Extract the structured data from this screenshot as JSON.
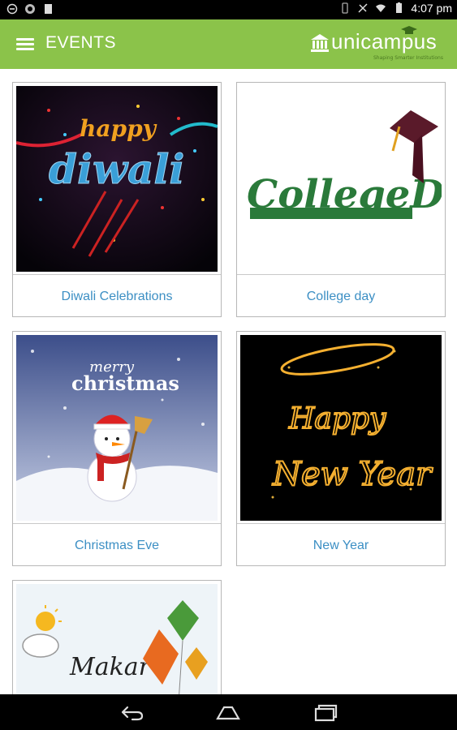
{
  "status_bar": {
    "time": "4:07 pm",
    "left_icons": [
      "minus-circle-icon",
      "sync-icon",
      "sd-card-icon"
    ],
    "right_icons": [
      "vibrate-icon",
      "no-signal-icon",
      "wifi-icon",
      "battery-icon"
    ]
  },
  "app_bar": {
    "title": "EVENTS",
    "logo_text": "unicampus",
    "logo_tagline": "Shaping Smarter Institutions",
    "background_color": "#8bc34a"
  },
  "events": [
    {
      "label": "Diwali Celebrations",
      "image": "diwali-image",
      "image_text": "happy diwali"
    },
    {
      "label": "College day",
      "image": "college-day-image",
      "image_text": "College Day"
    },
    {
      "label": "Christmas Eve",
      "image": "christmas-image",
      "image_text": "merry christmas"
    },
    {
      "label": "New Year",
      "image": "new-year-image",
      "image_text": "Happy New Year"
    },
    {
      "label": "",
      "image": "makar-image",
      "image_text": "Makar"
    }
  ],
  "nav_bar": {
    "buttons": [
      "back-icon",
      "home-icon",
      "recents-icon"
    ]
  },
  "colors": {
    "label_color": "#3c8fc4",
    "accent": "#8bc34a"
  }
}
